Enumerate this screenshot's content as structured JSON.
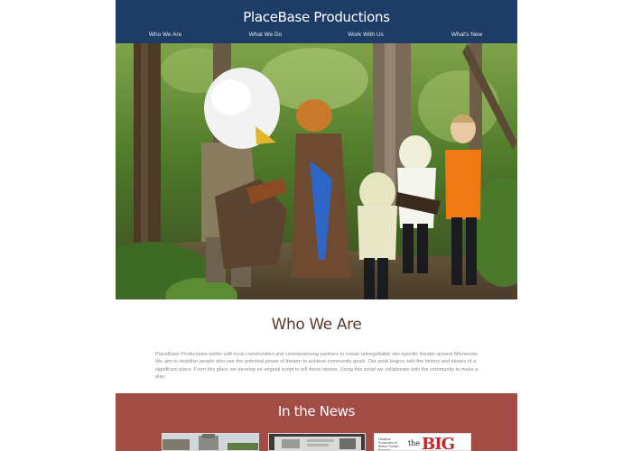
{
  "header": {
    "site_title": "PlaceBase Productions",
    "background_color": "#1d3c66",
    "nav": [
      {
        "label": "Who We Are"
      },
      {
        "label": "What We Do"
      },
      {
        "label": "Work With Us"
      },
      {
        "label": "What's New"
      }
    ]
  },
  "hero": {
    "image_name": "hero-photo"
  },
  "about": {
    "title": "Who We Are",
    "body": "PlaceBase Productions works with local communities and commissioning partners to create unforgettable site-specific theater around Minnesota. We aim to mobilize people who see the potential power of theatre to achieve community goals. Our work begins with the history and stories of a significant place. From this place we develop an original script to tell those stories. Using this script we collaborate with the community to make a play."
  },
  "news": {
    "title": "In the News",
    "background_color": "#a34b45",
    "items": [
      {
        "image_name": "news-thumbnail-1"
      },
      {
        "image_name": "news-thumbnail-2"
      },
      {
        "image_name": "news-thumbnail-3",
        "small_text": "Headline Production of Bethel Theater Presents",
        "word_the": "the",
        "word_big": "BIG"
      }
    ]
  }
}
